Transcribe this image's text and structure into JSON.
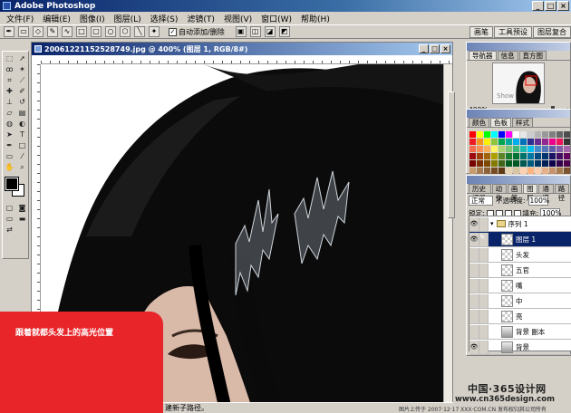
{
  "app": {
    "title": "Adobe Photoshop"
  },
  "window_buttons": {
    "minimize": "_",
    "maximize": "□",
    "close": "×"
  },
  "menu": [
    "文件(F)",
    "编辑(E)",
    "图像(I)",
    "图层(L)",
    "选择(S)",
    "滤镜(T)",
    "视图(V)",
    "窗口(W)",
    "帮助(H)"
  ],
  "options_bar": {
    "auto_add_delete_label": "自动添加/删除",
    "auto_add_delete_checked": true,
    "palette_well_tabs": [
      "画笔",
      "工具预设",
      "图层复合"
    ]
  },
  "document": {
    "title": "20061221152528749.jpg @ 400% (图层 1, RGB/8#)"
  },
  "callout": {
    "text": "跟着就都头发上的高光位置"
  },
  "status_bar": {
    "text": "建新子路径。"
  },
  "navigator": {
    "tabs": [
      "导航器",
      "信息",
      "直方图"
    ],
    "zoom": "400%"
  },
  "swatches_panel": {
    "tabs": [
      "颜色",
      "色板",
      "样式"
    ],
    "colors": [
      "#ff0000",
      "#ffff00",
      "#00ff00",
      "#00ffff",
      "#0000ff",
      "#ff00ff",
      "#ffffff",
      "#e6e6e6",
      "#cccccc",
      "#b3b3b3",
      "#999999",
      "#808080",
      "#666666",
      "#4d4d4d",
      "#ed1c24",
      "#f7941d",
      "#fff200",
      "#8dc63f",
      "#00a651",
      "#00a99d",
      "#00aeef",
      "#0072bc",
      "#2e3192",
      "#662d91",
      "#92278f",
      "#ec008c",
      "#ed145b",
      "#333333",
      "#f26c4f",
      "#f68e56",
      "#fbaf5d",
      "#fff568",
      "#acd373",
      "#7cc576",
      "#3cb878",
      "#1cbbb4",
      "#00bff3",
      "#448ccb",
      "#5674b9",
      "#605ca8",
      "#8560a8",
      "#a864a8",
      "#9e0b0f",
      "#a0410d",
      "#a36209",
      "#aba000",
      "#598527",
      "#197b30",
      "#007236",
      "#00746b",
      "#0076a3",
      "#004a80",
      "#003471",
      "#1b1464",
      "#440e62",
      "#630460",
      "#790000",
      "#7b2e00",
      "#7d4900",
      "#827b00",
      "#406618",
      "#005e20",
      "#005826",
      "#005952",
      "#005b7f",
      "#003663",
      "#002157",
      "#0d004c",
      "#32004b",
      "#4b0049",
      "#c69c6d",
      "#a67c52",
      "#8c6239",
      "#754c24",
      "#603913",
      "#e6d3b3",
      "#d9c4a0",
      "#ffd1b3",
      "#ffb380",
      "#f9cfb1",
      "#e8b08a",
      "#c7926c",
      "#a97c50",
      "#7a5230"
    ]
  },
  "layers_panel": {
    "tabs": [
      "历史记录",
      "动作",
      "画笔",
      "图层",
      "通道",
      "路径"
    ],
    "blend_mode": "正常",
    "opacity_label": "不透明度:",
    "opacity": "100%",
    "lock_label": "锁定:",
    "fill_label": "填充:",
    "fill": "100%",
    "layers": [
      {
        "name": "序列 1",
        "type": "group",
        "visible": true,
        "selected": false
      },
      {
        "name": "图层 1",
        "type": "layer",
        "visible": true,
        "selected": true
      },
      {
        "name": "头发",
        "type": "layer",
        "visible": false,
        "selected": false
      },
      {
        "name": "五官",
        "type": "layer",
        "visible": false,
        "selected": false
      },
      {
        "name": "嘴",
        "type": "layer",
        "visible": false,
        "selected": false
      },
      {
        "name": "中",
        "type": "layer",
        "visible": false,
        "selected": false
      },
      {
        "name": "亮",
        "type": "layer",
        "visible": false,
        "selected": false
      },
      {
        "name": "背景 副本",
        "type": "photo",
        "visible": false,
        "selected": false
      },
      {
        "name": "背景",
        "type": "photo",
        "visible": true,
        "selected": false
      }
    ]
  },
  "watermark": {
    "line1": "中国·365设计网",
    "line2": "www.cn365design.com",
    "line3": "图片上传于 2007·12·17 XXX·COM.CN 发布权归其公司所有"
  }
}
